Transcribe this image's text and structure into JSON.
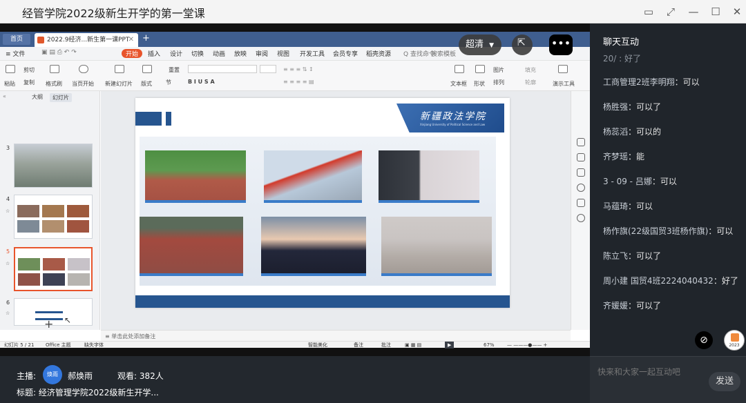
{
  "window": {
    "title": "经管学院2022级新生开学的第一堂课"
  },
  "wps": {
    "home_tab": "首页",
    "doc_tab": "2022.9经济...新生第一课PPT",
    "menu": [
      "≡ 文件",
      "开始",
      "插入",
      "设计",
      "切换",
      "动画",
      "放映",
      "审阅",
      "视图",
      "开发工具",
      "会员专享",
      "稻壳资源"
    ],
    "menu_search": "Q 查找命令",
    "menu_template": "搜索模板",
    "ribbon": {
      "paste": "粘贴",
      "cut": "剪切",
      "copy": "复制",
      "format_painter": "格式刷",
      "play_from_current": "当页开始",
      "new_slide": "新建幻灯片",
      "layout": "版式",
      "section": "节",
      "reset": "重置",
      "textbox": "文本框",
      "shape": "形状",
      "arrange": "排列",
      "picture": "图片",
      "fill": "填充",
      "outline": "轮廓",
      "presentation_tools": "演示工具"
    },
    "left_panel": {
      "tab_outline": "大纲",
      "tab_slides": "幻灯片",
      "slide_numbers": [
        "3",
        "4",
        "5",
        "6"
      ]
    },
    "slide": {
      "banner": "新疆政法学院",
      "banner_sub": "Xinjiang University of Political Science and Law"
    },
    "notes_placeholder": "单击此处添加备注",
    "status": {
      "slide_count": "幻灯片 5 / 21",
      "theme": "Office 主题",
      "missing_font": "缺失字体",
      "beautify": "智能美化",
      "notes": "备注",
      "comments": "批注",
      "zoom": "67%"
    }
  },
  "stream_controls": {
    "quality": "超清",
    "more": "•••"
  },
  "chat": {
    "title": "聊天互动",
    "faded": "20/ :  好了",
    "messages": [
      {
        "user": "工商管理2班李明翔",
        "text": "可以"
      },
      {
        "user": "杨胜强",
        "text": "可以了"
      },
      {
        "user": "杨蕊滔",
        "text": "可以的"
      },
      {
        "user": "齐梦瑶",
        "text": "能"
      },
      {
        "user": "3 - 09 - 吕娜",
        "text": "可以"
      },
      {
        "user": "马蕴琦",
        "text": "可以"
      },
      {
        "user": "杨作旗(22级国贸3班杨作旗)",
        "text": "可以"
      },
      {
        "user": "陈立飞",
        "text": "可以了"
      },
      {
        "user": "周小建 国贸4班2224040432",
        "text": "好了"
      },
      {
        "user": "齐媛媛",
        "text": "可以了"
      }
    ],
    "avatar_label": "2023",
    "input_placeholder": "快来和大家一起互动吧",
    "send": "发送"
  },
  "footer": {
    "host_label": "主播:",
    "host_avatar": "焕雨",
    "host_name": "郝焕雨",
    "viewers": "观看: 382人",
    "topic": "标题:  经济管理学院2022级新生开学..."
  },
  "colors": {
    "slide_blue": "#26558f",
    "accent_orange": "#e8542b",
    "chat_bg": "#20252b"
  }
}
